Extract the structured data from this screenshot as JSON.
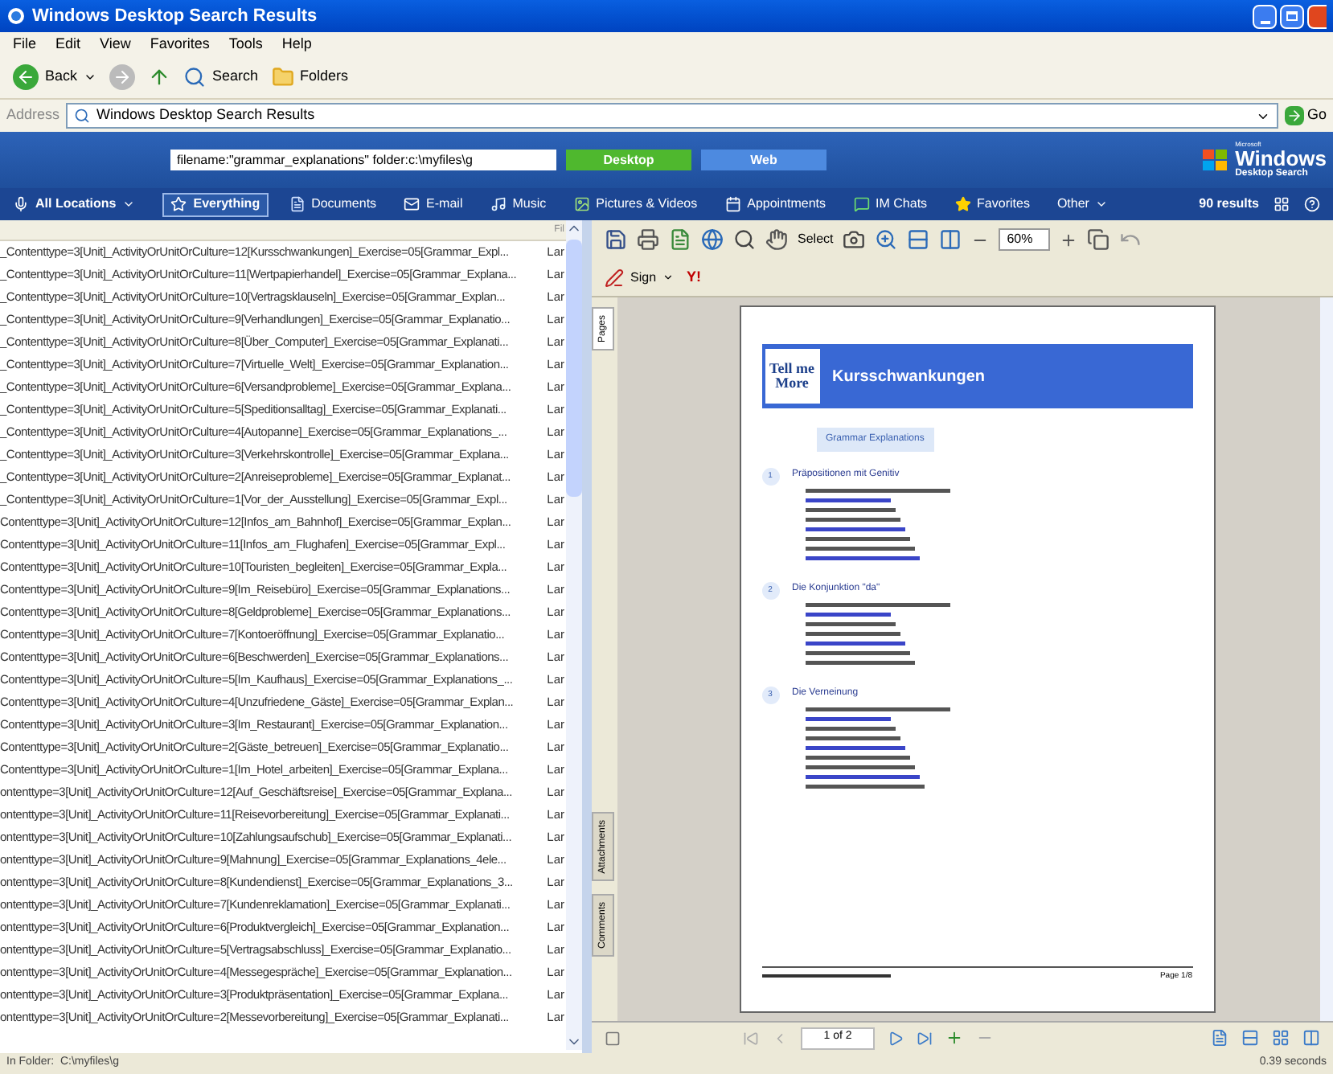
{
  "window": {
    "title": "Windows Desktop Search Results"
  },
  "menu": [
    "File",
    "Edit",
    "View",
    "Favorites",
    "Tools",
    "Help"
  ],
  "toolbar": {
    "back": "Back",
    "search": "Search",
    "folders": "Folders"
  },
  "address": {
    "label": "Address",
    "value": "Windows Desktop Search Results",
    "go": "Go"
  },
  "search": {
    "query": "filename:\"grammar_explanations\" folder:c:\\myfiles\\g",
    "scopes": [
      {
        "label": "Desktop",
        "selected": true
      },
      {
        "label": "Web",
        "selected": false
      }
    ]
  },
  "logo": {
    "brand": "Microsoft",
    "name": "Windows",
    "subtitle": "Desktop Search"
  },
  "locations": "All Locations",
  "categories": [
    {
      "label": "Everything",
      "kind": "category",
      "selected": true
    },
    {
      "label": "Documents",
      "kind": "category",
      "selected": false
    },
    {
      "label": "E-mail",
      "kind": "category",
      "selected": false
    },
    {
      "label": "Music",
      "kind": "category",
      "selected": false
    },
    {
      "label": "Pictures & Videos",
      "kind": "category",
      "selected": false
    },
    {
      "label": "Appointments",
      "kind": "category",
      "selected": false
    },
    {
      "label": "IM Chats",
      "kind": "category",
      "selected": false
    },
    {
      "label": "Favorites",
      "kind": "category",
      "selected": false
    },
    {
      "label": "Other",
      "kind": "menu",
      "selected": false
    }
  ],
  "result_count": "90 results",
  "results": {
    "column_2_header": "Fil",
    "rows": [
      {
        "name": "_Contenttype=3[Unit]_ActivityOrUnitOrCulture=12[Kursschwankungen]_Exercise=05[Grammar_Expl...",
        "column_2": "Lar"
      },
      {
        "name": "_Contenttype=3[Unit]_ActivityOrUnitOrCulture=11[Wertpapierhandel]_Exercise=05[Grammar_Explana...",
        "column_2": "Lar"
      },
      {
        "name": "_Contenttype=3[Unit]_ActivityOrUnitOrCulture=10[Vertragsklauseln]_Exercise=05[Grammar_Explan...",
        "column_2": "Lar"
      },
      {
        "name": "_Contenttype=3[Unit]_ActivityOrUnitOrCulture=9[Verhandlungen]_Exercise=05[Grammar_Explanatio...",
        "column_2": "Lar"
      },
      {
        "name": "_Contenttype=3[Unit]_ActivityOrUnitOrCulture=8[Über_Computer]_Exercise=05[Grammar_Explanati...",
        "column_2": "Lar"
      },
      {
        "name": "_Contenttype=3[Unit]_ActivityOrUnitOrCulture=7[Virtuelle_Welt]_Exercise=05[Grammar_Explanation...",
        "column_2": "Lar"
      },
      {
        "name": "_Contenttype=3[Unit]_ActivityOrUnitOrCulture=6[Versandprobleme]_Exercise=05[Grammar_Explana...",
        "column_2": "Lar"
      },
      {
        "name": "_Contenttype=3[Unit]_ActivityOrUnitOrCulture=5[Speditionsalltag]_Exercise=05[Grammar_Explanati...",
        "column_2": "Lar"
      },
      {
        "name": "_Contenttype=3[Unit]_ActivityOrUnitOrCulture=4[Autopanne]_Exercise=05[Grammar_Explanations_...",
        "column_2": "Lar"
      },
      {
        "name": "_Contenttype=3[Unit]_ActivityOrUnitOrCulture=3[Verkehrskontrolle]_Exercise=05[Grammar_Explana...",
        "column_2": "Lar"
      },
      {
        "name": "_Contenttype=3[Unit]_ActivityOrUnitOrCulture=2[Anreiseprobleme]_Exercise=05[Grammar_Explanat...",
        "column_2": "Lar"
      },
      {
        "name": "_Contenttype=3[Unit]_ActivityOrUnitOrCulture=1[Vor_der_Ausstellung]_Exercise=05[Grammar_Expl...",
        "column_2": "Lar"
      },
      {
        "name": "Contenttype=3[Unit]_ActivityOrUnitOrCulture=12[Infos_am_Bahnhof]_Exercise=05[Grammar_Explan...",
        "column_2": "Lar"
      },
      {
        "name": "Contenttype=3[Unit]_ActivityOrUnitOrCulture=11[Infos_am_Flughafen]_Exercise=05[Grammar_Expl...",
        "column_2": "Lar"
      },
      {
        "name": "Contenttype=3[Unit]_ActivityOrUnitOrCulture=10[Touristen_begleiten]_Exercise=05[Grammar_Expla...",
        "column_2": "Lar"
      },
      {
        "name": "Contenttype=3[Unit]_ActivityOrUnitOrCulture=9[Im_Reisebüro]_Exercise=05[Grammar_Explanations...",
        "column_2": "Lar"
      },
      {
        "name": "Contenttype=3[Unit]_ActivityOrUnitOrCulture=8[Geldprobleme]_Exercise=05[Grammar_Explanations...",
        "column_2": "Lar"
      },
      {
        "name": "Contenttype=3[Unit]_ActivityOrUnitOrCulture=7[Kontoeröffnung]_Exercise=05[Grammar_Explanatio...",
        "column_2": "Lar"
      },
      {
        "name": "Contenttype=3[Unit]_ActivityOrUnitOrCulture=6[Beschwerden]_Exercise=05[Grammar_Explanations...",
        "column_2": "Lar"
      },
      {
        "name": "Contenttype=3[Unit]_ActivityOrUnitOrCulture=5[Im_Kaufhaus]_Exercise=05[Grammar_Explanations_...",
        "column_2": "Lar"
      },
      {
        "name": "Contenttype=3[Unit]_ActivityOrUnitOrCulture=4[Unzufriedene_Gäste]_Exercise=05[Grammar_Explan...",
        "column_2": "Lar"
      },
      {
        "name": "Contenttype=3[Unit]_ActivityOrUnitOrCulture=3[Im_Restaurant]_Exercise=05[Grammar_Explanation...",
        "column_2": "Lar"
      },
      {
        "name": "Contenttype=3[Unit]_ActivityOrUnitOrCulture=2[Gäste_betreuen]_Exercise=05[Grammar_Explanatio...",
        "column_2": "Lar"
      },
      {
        "name": "Contenttype=3[Unit]_ActivityOrUnitOrCulture=1[Im_Hotel_arbeiten]_Exercise=05[Grammar_Explana...",
        "column_2": "Lar"
      },
      {
        "name": "ontenttype=3[Unit]_ActivityOrUnitOrCulture=12[Auf_Geschäftsreise]_Exercise=05[Grammar_Explana...",
        "column_2": "Lar"
      },
      {
        "name": "ontenttype=3[Unit]_ActivityOrUnitOrCulture=11[Reisevorbereitung]_Exercise=05[Grammar_Explanati...",
        "column_2": "Lar"
      },
      {
        "name": "ontenttype=3[Unit]_ActivityOrUnitOrCulture=10[Zahlungsaufschub]_Exercise=05[Grammar_Explanati...",
        "column_2": "Lar"
      },
      {
        "name": "ontenttype=3[Unit]_ActivityOrUnitOrCulture=9[Mahnung]_Exercise=05[Grammar_Explanations_4ele...",
        "column_2": "Lar"
      },
      {
        "name": "ontenttype=3[Unit]_ActivityOrUnitOrCulture=8[Kundendienst]_Exercise=05[Grammar_Explanations_3...",
        "column_2": "Lar"
      },
      {
        "name": "ontenttype=3[Unit]_ActivityOrUnitOrCulture=7[Kundenreklamation]_Exercise=05[Grammar_Explanati...",
        "column_2": "Lar"
      },
      {
        "name": "ontenttype=3[Unit]_ActivityOrUnitOrCulture=6[Produktvergleich]_Exercise=05[Grammar_Explanation...",
        "column_2": "Lar"
      },
      {
        "name": "ontenttype=3[Unit]_ActivityOrUnitOrCulture=5[Vertragsabschluss]_Exercise=05[Grammar_Explanatio...",
        "column_2": "Lar"
      },
      {
        "name": "ontenttype=3[Unit]_ActivityOrUnitOrCulture=4[Messegespräche]_Exercise=05[Grammar_Explanation...",
        "column_2": "Lar"
      },
      {
        "name": "ontenttype=3[Unit]_ActivityOrUnitOrCulture=3[Produktpräsentation]_Exercise=05[Grammar_Explana...",
        "column_2": "Lar"
      },
      {
        "name": "ontenttype=3[Unit]_ActivityOrUnitOrCulture=2[Messevorbereitung]_Exercise=05[Grammar_Explanati...",
        "column_2": "Lar"
      }
    ]
  },
  "preview": {
    "toolbar": {
      "select": "Select",
      "zoom": "60%",
      "sign": "Sign",
      "yahoo": "Y!"
    },
    "side_tabs": [
      {
        "label": "Pages",
        "selected": true
      },
      {
        "label": "Attachments",
        "selected": false
      },
      {
        "label": "Comments",
        "selected": false
      }
    ],
    "document": {
      "logo": "Tell me More",
      "title": "Kursschwankungen",
      "section": "Grammar Explanations",
      "topics": [
        {
          "number": "1",
          "heading": "Präpositionen mit Genitiv"
        },
        {
          "number": "2",
          "heading": "Die Konjunktion \"da\""
        },
        {
          "number": "3",
          "heading": "Die Verneinung"
        }
      ],
      "footer": "Page 1/8"
    },
    "page_field": "1 of 2"
  },
  "status_bar": {
    "folder": "In Folder:  C:\\myfiles\\g",
    "time": "0.39 seconds"
  }
}
